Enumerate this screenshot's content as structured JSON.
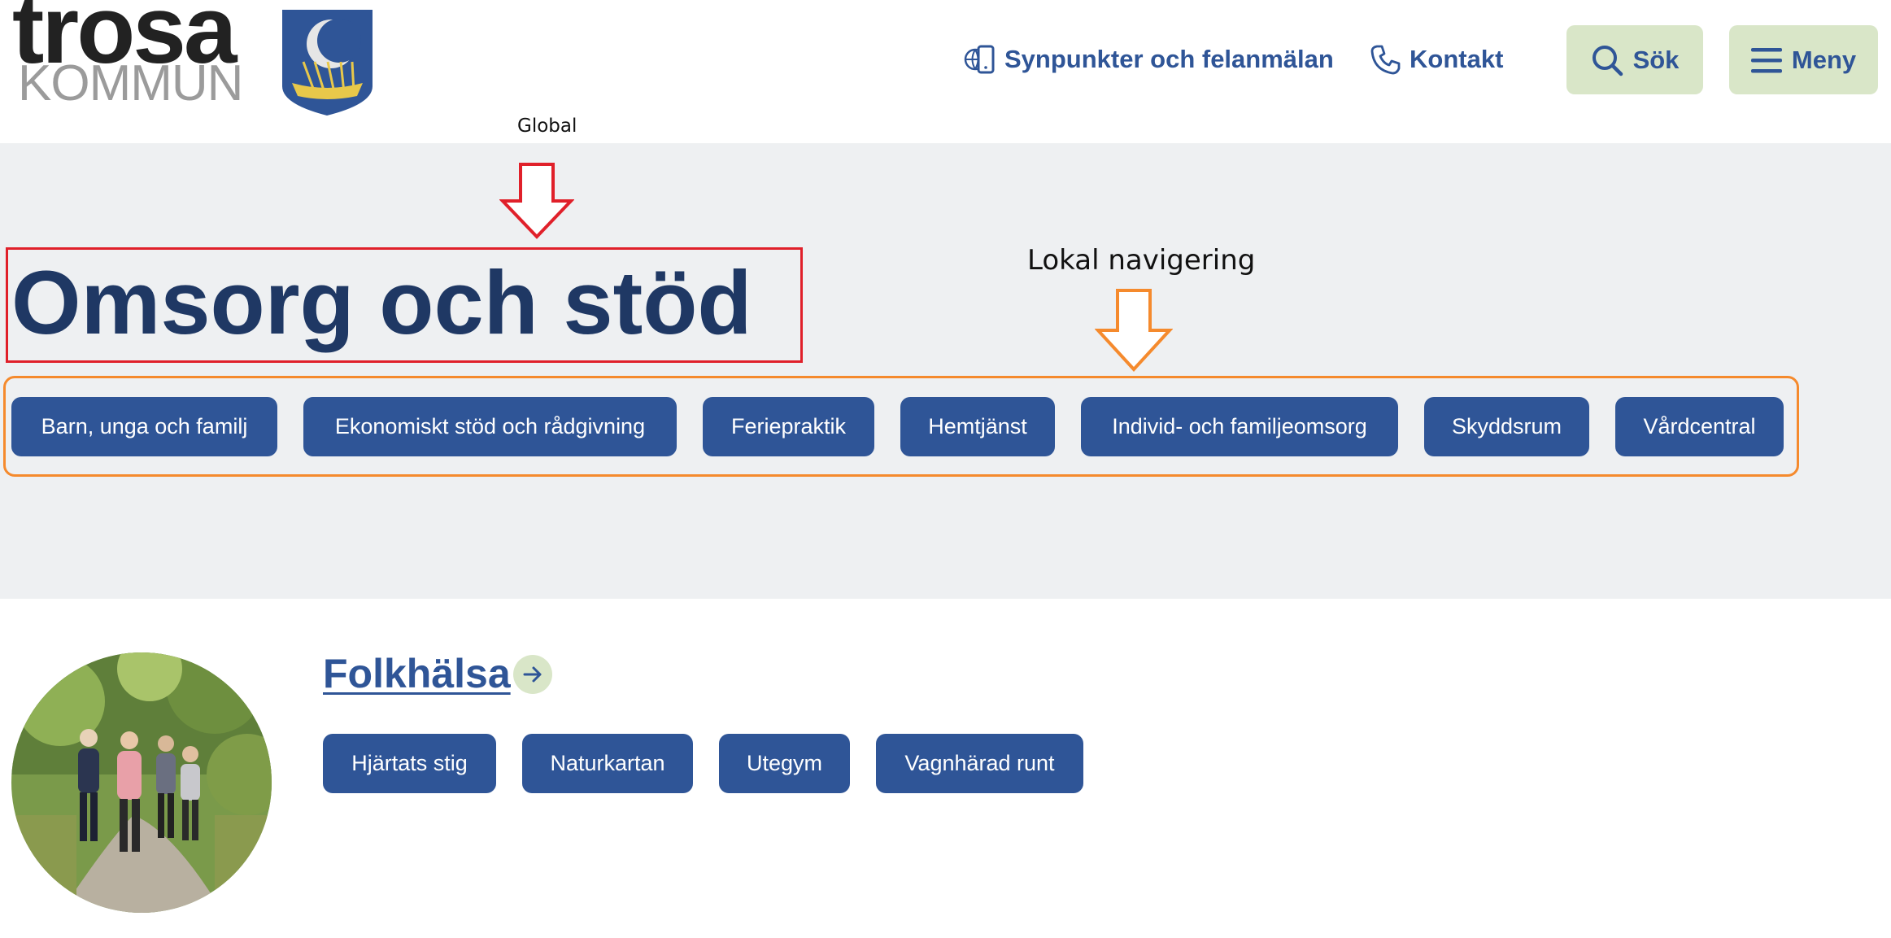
{
  "header": {
    "logo_word": "trosa",
    "logo_sub": "KOMMUN",
    "links": [
      {
        "label": "Synpunkter och felanmälan",
        "icon": "phone-globe-icon"
      },
      {
        "label": "Kontakt",
        "icon": "phone-icon"
      }
    ],
    "search_label": "Sök",
    "menu_label": "Meny"
  },
  "annotations": {
    "global": "Global",
    "local": "Lokal navigering"
  },
  "hero": {
    "title": "Omsorg och stöd",
    "nav": [
      "Barn, unga och familj",
      "Ekonomiskt stöd och rådgivning",
      "Feriepraktik",
      "Hemtjänst",
      "Individ- och familjeomsorg",
      "Skyddsrum",
      "Vårdcentral"
    ]
  },
  "section": {
    "title": "Folkhälsa",
    "links": [
      "Hjärtats stig",
      "Naturkartan",
      "Utegym",
      "Vagnhärad runt"
    ]
  },
  "colors": {
    "primary": "#2f5597",
    "title": "#1f3864",
    "accent_green": "#d9e6c8",
    "hero_bg": "#eef0f2",
    "annot_red": "#e0202a",
    "annot_orange": "#f58a2d"
  }
}
